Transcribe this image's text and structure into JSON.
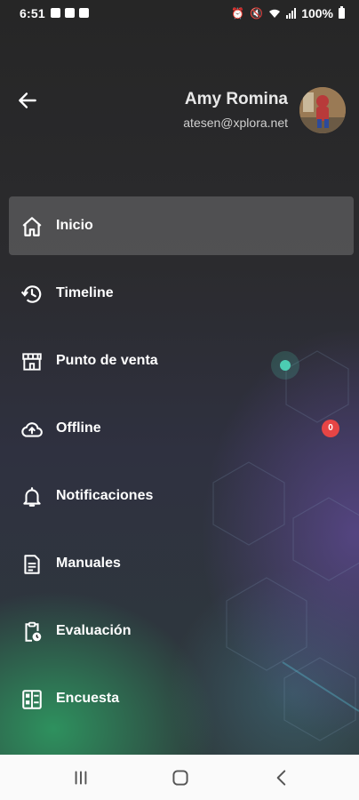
{
  "status_bar": {
    "time": "6:51",
    "battery_text": "100%",
    "left_icons": [
      "photo-icon",
      "files-icon",
      "app-icon"
    ],
    "right_icons": [
      "alarm-icon",
      "mute-icon",
      "wifi-icon",
      "signal-icon",
      "battery-icon"
    ]
  },
  "header": {
    "back_icon": "arrow-left-icon",
    "user_name": "Amy Romina",
    "user_email": "atesen@xplora.net",
    "avatar": "user-avatar"
  },
  "menu": {
    "items": [
      {
        "label": "Inicio",
        "icon": "home-icon",
        "active": true
      },
      {
        "label": "Timeline",
        "icon": "history-icon"
      },
      {
        "label": "Punto de venta",
        "icon": "store-icon"
      },
      {
        "label": "Offline",
        "icon": "cloud-upload-icon",
        "badge": "0"
      },
      {
        "label": "Notificaciones",
        "icon": "bell-icon"
      },
      {
        "label": "Manuales",
        "icon": "document-icon"
      },
      {
        "label": "Evaluación",
        "icon": "clipboard-clock-icon"
      },
      {
        "label": "Encuesta",
        "icon": "survey-icon"
      }
    ]
  },
  "colors": {
    "badge": "#e64545",
    "active_bg": "#5a5a5a",
    "accent_green": "#2ea064",
    "accent_purple": "#604a96"
  },
  "nav_bar": {
    "buttons": [
      "recent-apps-icon",
      "home-circle-icon",
      "back-chevron-icon"
    ]
  }
}
